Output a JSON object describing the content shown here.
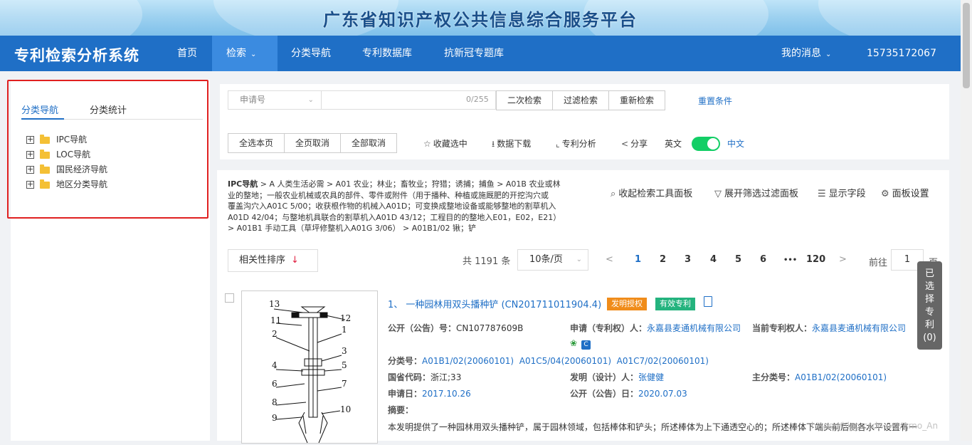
{
  "banner": {
    "title": "广东省知识产权公共信息综合服务平台"
  },
  "header": {
    "system_title": "专利检索分析系统",
    "nav": [
      {
        "label": "首页"
      },
      {
        "label": "检索",
        "active": true,
        "dropdown": true
      },
      {
        "label": "分类导航"
      },
      {
        "label": "专利数据库"
      },
      {
        "label": "抗新冠专题库"
      }
    ],
    "messages_label": "我的消息",
    "user_label": "15735172067"
  },
  "sidebar": {
    "tabs": [
      {
        "label": "分类导航",
        "active": true
      },
      {
        "label": "分类统计"
      }
    ],
    "tree": [
      {
        "label": "IPC导航"
      },
      {
        "label": "LOC导航"
      },
      {
        "label": "国民经济导航"
      },
      {
        "label": "地区分类导航"
      }
    ]
  },
  "search": {
    "field_select": "申请号",
    "input_value": "",
    "counter": "0/255",
    "buttons": [
      "二次检索",
      "过滤检索",
      "重新检索"
    ],
    "reset_label": "重置条件",
    "select_buttons": [
      "全选本页",
      "全页取消",
      "全部取消"
    ],
    "tools": {
      "favorite": "收藏选中",
      "download": "数据下载",
      "analysis": "专利分析",
      "share": "分享",
      "lang_en": "英文",
      "lang_zh": "中文"
    }
  },
  "results": {
    "breadcrumb_prefix": "IPC导航",
    "breadcrumb_lines": [
      " > A 人类生活必需 > A01 农业；林业；畜牧业；狩猎；诱捕；捕鱼 > A01B 农业或林",
      "业的整地；一般农业机械或农具的部件、零件或附件（用于播种、种植或施厩肥的开挖沟穴或",
      "覆盖沟穴入A01C 5/00；收获根作物的机械入A01D；可变换成整地设备或能够整地的割草机入",
      "A01D 42/04；与整地机具联合的割草机入A01D 43/12；工程目的的整地入E01，E02，E21）",
      "> A01B1 手动工具（草坪修整机入A01G 3/06） > A01B1/02 锹；铲"
    ],
    "tools": {
      "collapse_search": "收起检索工具面板",
      "expand_filter": "展开筛选过滤面板",
      "show_fields": "显示字段",
      "panel_settings": "面板设置"
    },
    "sort_label": "相关性排序",
    "sort_arrow": "↓",
    "total_text": "共 1191 条",
    "page_size": "10条/页",
    "pages": [
      "1",
      "2",
      "3",
      "4",
      "5",
      "6",
      "•••",
      "120"
    ],
    "current_page": "1",
    "goto_label": "前往",
    "goto_value": "1",
    "page_suffix": "页"
  },
  "patent": {
    "title": "1、 一种园林用双头播种铲 (CN201711011904.4)",
    "tag_type": "发明授权",
    "tag_status": "有效专利",
    "pub_no_label": "公开（公告）号：",
    "pub_no": "CN107787609B",
    "applicant_label": "申请（专利权）人：",
    "applicant": "永嘉县麦通机械有限公司",
    "owner_label": "当前专利权人：",
    "owner": "永嘉县麦通机械有限公司",
    "class_label": "分类号：",
    "classes": [
      "A01B1/02(20060101)",
      "A01C5/04(20060101)",
      "A01C7/02(20060101)"
    ],
    "province_label": "国省代码：",
    "province": "浙江;33",
    "inventor_label": "发明（设计）人：",
    "inventor": "张健健",
    "main_class_label": "主分类号：",
    "main_class": "A01B1/02(20060101)",
    "app_date_label": "申请日：",
    "app_date": "2017.10.26",
    "pub_date_label": "公开（公告）日：",
    "pub_date": "2020.07.03",
    "abstract_label": "摘要：",
    "abstract": "本发明提供了一种园林用双头播种铲，属于园林领域，包括棒体和铲头；所述棒体为上下通透空心的；所述棒体下端头前后侧各水平设置有一",
    "figure_labels": [
      "13",
      "12",
      "11",
      "2",
      "1",
      "3",
      "4",
      "5",
      "6",
      "7",
      "8",
      "9",
      "10"
    ]
  },
  "float_panel": {
    "label": "已选择专利",
    "count": "(0)"
  },
  "watermark": "https://blog.csdn.net/Arno_An"
}
